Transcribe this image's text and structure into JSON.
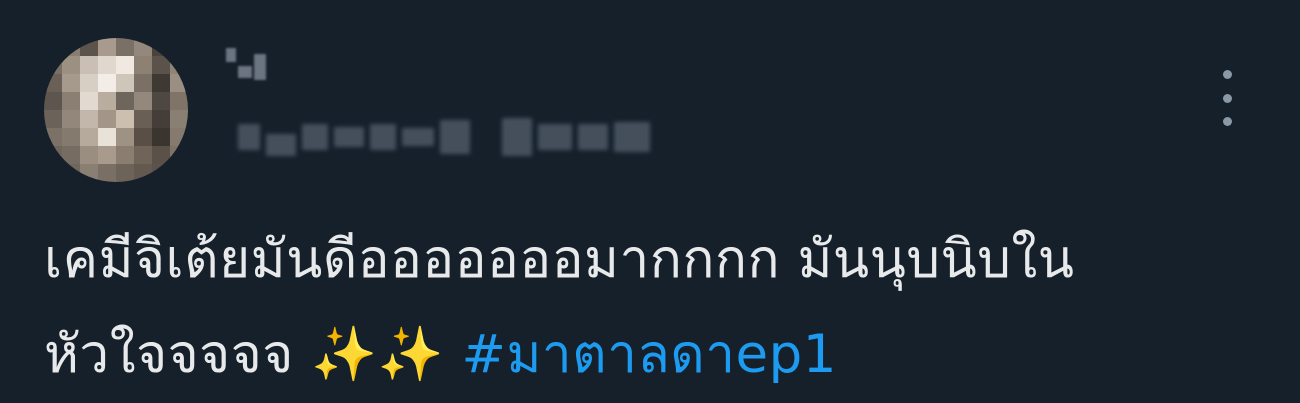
{
  "tweet": {
    "text_line_1": "เคมีจิเต้ยมันดีอออออออมากกกก มันนุบนิบใน",
    "text_line_2": "หัวใจจจจจ ",
    "sparkles": "✨✨",
    "hashtag": "#มาตาลดาep1"
  },
  "colors": {
    "background": "#15202b",
    "text": "#e7e9ea",
    "link": "#1d9bf0",
    "muted": "#8b98a5"
  },
  "icons": {
    "more": "vertical-ellipsis-icon"
  }
}
